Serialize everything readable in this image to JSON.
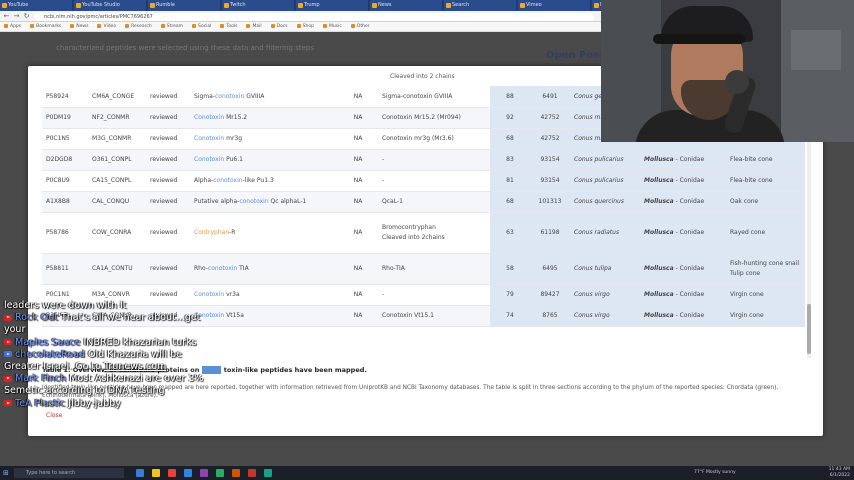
{
  "browser": {
    "tabs": [
      {
        "title": "YouTube"
      },
      {
        "title": "YouTube Studio"
      },
      {
        "title": "Rumble"
      },
      {
        "title": "Twitch"
      },
      {
        "title": "Trump"
      },
      {
        "title": "News"
      },
      {
        "title": "Search"
      },
      {
        "title": "Vimeo"
      },
      {
        "title": "Docs"
      },
      {
        "title": "Mail"
      },
      {
        "title": "Open Peer Review"
      }
    ],
    "active_tab_index": 10,
    "url": "ncbi.nlm.nih.gov/pmc/articles/PMC7696267",
    "bookmarks": [
      "Apps",
      "Bookmarks",
      "News",
      "Video",
      "Research",
      "Stream",
      "Social",
      "Tools",
      "Mail",
      "Docs",
      "Shop",
      "Music",
      "Other"
    ]
  },
  "page_background": {
    "text": "characterized peptides were selected using these data and filtering steps",
    "heading": "Open Peer"
  },
  "modal": {
    "partial_top_text": "Cleaved into 2 chains",
    "rows": [
      {
        "accession": "P58924",
        "entry": "CM6A_CONGE",
        "status": "reviewed",
        "name": [
          {
            "t": "Sigma-"
          },
          {
            "t": "conotoxin",
            "h": "blue"
          },
          {
            "t": " GVIIIA"
          }
        ],
        "na": "NA",
        "chain": "Sigma-conotoxin GVIIIA",
        "length": "88",
        "taxid": "6491",
        "species": "Conus ge...",
        "phylum": "",
        "family": "",
        "common": ""
      },
      {
        "accession": "P0DM19",
        "entry": "NF2_CONMR",
        "status": "reviewed",
        "name": [
          {
            "t": "Conotoxin",
            "h": "blue"
          },
          {
            "t": " Mr15.2"
          }
        ],
        "na": "NA",
        "chain": "Conotoxin Mr15.2 (Mr094)",
        "length": "92",
        "taxid": "42752",
        "species": "Conus m...",
        "phylum": "",
        "family": "",
        "common": ""
      },
      {
        "accession": "P0C1N5",
        "entry": "M3G_CONMR",
        "status": "reviewed",
        "name": [
          {
            "t": "Conotoxin",
            "h": "blue"
          },
          {
            "t": " mr3g"
          }
        ],
        "na": "NA",
        "chain": "Conotoxin mr3g (Mr3.6)",
        "length": "68",
        "taxid": "42752",
        "species": "Conus marmoreus",
        "phylum": "Mollusca",
        "family": "Conidae",
        "common": "Marble cone"
      },
      {
        "accession": "D2DGD8",
        "entry": "O361_CONPL",
        "status": "reviewed",
        "name": [
          {
            "t": "Conotoxin",
            "h": "blue"
          },
          {
            "t": " Pu6.1"
          }
        ],
        "na": "NA",
        "chain": "-",
        "length": "83",
        "taxid": "93154",
        "species": "Conus pulicarius",
        "phylum": "Mollusca",
        "family": "Conidae",
        "common": "Flea-bite cone"
      },
      {
        "accession": "P0C8U9",
        "entry": "CA15_CONPL",
        "status": "reviewed",
        "name": [
          {
            "t": "Alpha-"
          },
          {
            "t": "conotoxin",
            "h": "blue"
          },
          {
            "t": "-like Pu1.3"
          }
        ],
        "na": "NA",
        "chain": "-",
        "length": "81",
        "taxid": "93154",
        "species": "Conus pulicarius",
        "phylum": "Mollusca",
        "family": "Conidae",
        "common": "Flea-bite cone"
      },
      {
        "accession": "A1X8B8",
        "entry": "CAL_CONQU",
        "status": "reviewed",
        "name": [
          {
            "t": "Putative alpha-"
          },
          {
            "t": "conotoxin",
            "h": "blue"
          },
          {
            "t": " Qc alphaL-1"
          }
        ],
        "na": "NA",
        "chain": "QcaL-1",
        "length": "68",
        "taxid": "101313",
        "species": "Conus quercinus",
        "phylum": "Mollusca",
        "family": "Conidae",
        "common": "Oak cone"
      },
      {
        "accession": "P58786",
        "entry": "COW_CONRA",
        "status": "reviewed",
        "name": [
          {
            "t": "Contryphan",
            "h": "orange"
          },
          {
            "t": "-R"
          }
        ],
        "na": "NA",
        "chain": "Bromocontryphan\nCleaved into 2chains",
        "length": "63",
        "taxid": "61198",
        "species": "Conus radiatus",
        "phylum": "Mollusca",
        "family": "Conidae",
        "common": "Rayed cone"
      },
      {
        "accession": "P58811",
        "entry": "CA1A_CONTU",
        "status": "reviewed",
        "name": [
          {
            "t": "Rho-"
          },
          {
            "t": "conotoxin",
            "h": "blue"
          },
          {
            "t": " TIA"
          }
        ],
        "na": "NA",
        "chain": "Rho-TIA",
        "length": "58",
        "taxid": "6495",
        "species": "Conus tulipa",
        "phylum": "Mollusca",
        "family": "Conidae",
        "common": "Fish-hunting cone snail\nTulip cone"
      },
      {
        "accession": "P0C1N1",
        "entry": "M3A_CONVR",
        "status": "reviewed",
        "name": [
          {
            "t": "Conotoxin",
            "h": "blue"
          },
          {
            "t": " vr3a"
          }
        ],
        "na": "NA",
        "chain": "-",
        "length": "79",
        "taxid": "89427",
        "species": "Conus virgo",
        "phylum": "Mollusca",
        "family": "Conidae",
        "common": "Virgin cone"
      },
      {
        "accession": "B3FIA5",
        "entry": "CVFA_CONVR",
        "status": "reviewed",
        "name": [
          {
            "t": "Conotoxin",
            "h": "blue"
          },
          {
            "t": " Vt15a"
          }
        ],
        "na": "NA",
        "chain": "Conotoxin Vt15.1",
        "length": "74",
        "taxid": "8765",
        "species": "Conus virgo",
        "phylum": "Mollusca",
        "family": "Conidae",
        "common": "Virgin cone"
      }
    ],
    "caption_prefix": "Table 1. Overview of candidate proteins on",
    "caption_suffix": "toxin-like peptides have been mapped.",
    "caption_description": "Identified toxin-like peptides have been mapped are here reported, together with information retrieved from UniprotKB and NCBI Taxonomy databases. The table is split in three sections according to the phylum of the reported species: Chordata (green), Echinodermata (pink), Mollusca (azure).",
    "close_label": "Close"
  },
  "chat": [
    {
      "platform": "",
      "user": "",
      "text": "leaders were down with it",
      "link": ""
    },
    {
      "platform": "youtube",
      "user": "Rock Out",
      "text": "That's all we hear about...get",
      "link": ""
    },
    {
      "platform": "",
      "user": "",
      "text": "your",
      "link": ""
    },
    {
      "platform": "youtube",
      "user": "Maples Sauce",
      "text": "INBRED khazarian turks",
      "link": ""
    },
    {
      "platform": "facebook",
      "user": "chocolateRoad",
      "text": "Old Khazaria will be",
      "link": ""
    },
    {
      "platform": "",
      "user": "",
      "text": "Greater Israel. Go to ",
      "link": "Trunews.com"
    },
    {
      "platform": "youtube",
      "user": "Mark Finch",
      "text": "Most Ashkenazi are over 3%",
      "link": ""
    },
    {
      "platform": "",
      "user": "",
      "text": "Semetic according to DNA testing",
      "link": ""
    },
    {
      "platform": "youtube",
      "user": "TeA Plastic",
      "text": "Jibby-jabby",
      "link": ""
    }
  ],
  "taskbar": {
    "search_placeholder": "Type here to search",
    "weather": "77°F Mostly sunny",
    "time": "11:43 AM",
    "date": "6/1/2022"
  },
  "colors": {
    "highlight_blue": "#5b8fd6",
    "highlight_orange": "#e39a3a",
    "taxonomy_bg": "#dde6f3",
    "chat_user": "#6a8ff0"
  }
}
